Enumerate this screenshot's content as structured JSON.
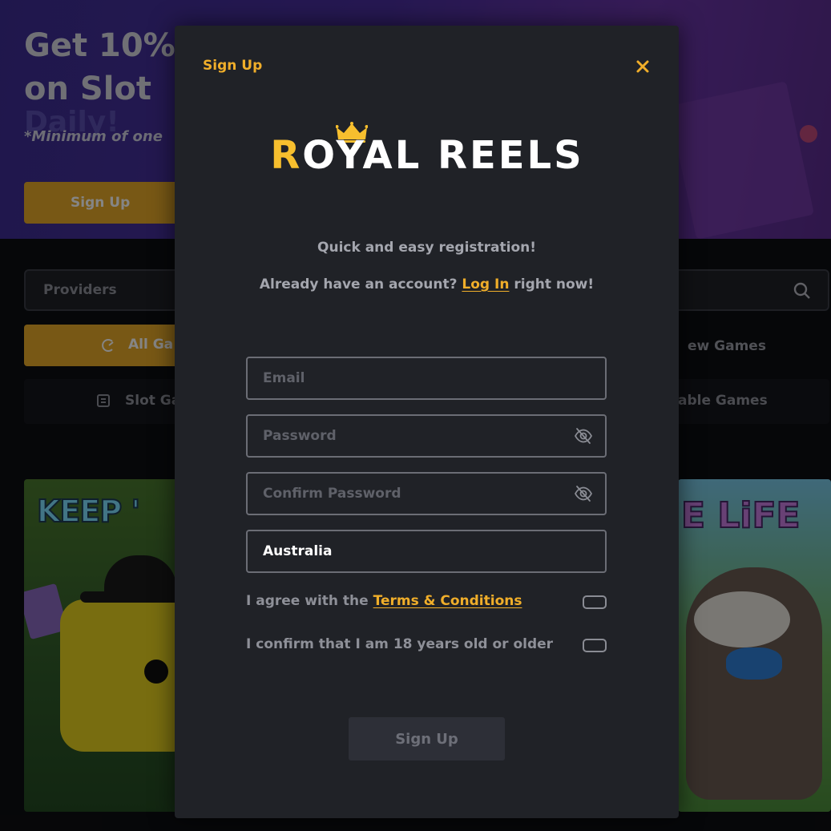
{
  "background": {
    "hero": {
      "title_line1": "Get 10%",
      "title_line2": "on Slot",
      "ghost_text": "Daily!",
      "note": "*Minimum of one",
      "cta_label": "Sign Up"
    },
    "filter": {
      "providers_label": "Providers"
    },
    "tabs": {
      "all": "All Ga",
      "new": "ew Games",
      "slot": "Slot Ga",
      "table": "able Games"
    },
    "cards": {
      "left_title": "KEEP '",
      "right_title": "E LiFE"
    }
  },
  "modal": {
    "title": "Sign Up",
    "logo": {
      "initial": "R",
      "rest": "OYAL REELS"
    },
    "tagline": "Quick and easy registration!",
    "login_prompt": {
      "before": "Already have an account?",
      "link": "Log In",
      "after": "right now!"
    },
    "fields": {
      "email_placeholder": "Email",
      "password_placeholder": "Password",
      "confirm_placeholder": "Confirm Password",
      "country_value": "Australia"
    },
    "checks": {
      "terms_before": "I agree with the",
      "terms_link": "Terms & Conditions",
      "age": "I confirm that I am 18 years old or older"
    },
    "submit_label": "Sign Up"
  },
  "colors": {
    "accent": "#f0ae2a",
    "modal_bg": "#202227",
    "field_border": "#6b6d75",
    "submit_bg": "#2d2f37"
  }
}
